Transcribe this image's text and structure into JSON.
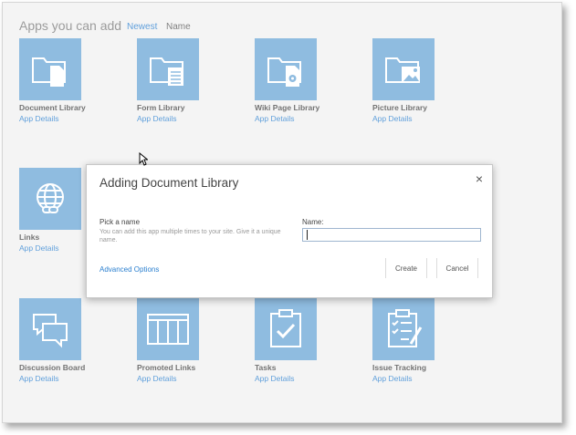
{
  "header": {
    "title": "Apps you can add",
    "sort_newest": "Newest",
    "sort_name": "Name"
  },
  "tiles": [
    {
      "title": "Document Library",
      "details": "App Details",
      "icon": "document-library-icon"
    },
    {
      "title": "Form Library",
      "details": "App Details",
      "icon": "form-library-icon"
    },
    {
      "title": "Wiki Page Library",
      "details": "App Details",
      "icon": "wiki-page-library-icon"
    },
    {
      "title": "Picture Library",
      "details": "App Details",
      "icon": "picture-library-icon"
    },
    {
      "title": "Links",
      "details": "App Details",
      "icon": "links-globe-icon"
    },
    {
      "title": "Discussion Board",
      "details": "App Details",
      "icon": "discussion-board-icon"
    },
    {
      "title": "Promoted Links",
      "details": "App Details",
      "icon": "promoted-links-icon"
    },
    {
      "title": "Tasks",
      "details": "App Details",
      "icon": "tasks-clipboard-icon"
    },
    {
      "title": "Issue Tracking",
      "details": "App Details",
      "icon": "issue-tracking-icon"
    }
  ],
  "dialog": {
    "title": "Adding Document Library",
    "close": "×",
    "pick_label": "Pick a name",
    "pick_description": "You can add this app multiple times to your site. Give it a unique name.",
    "name_label": "Name:",
    "name_value": "",
    "advanced_options": "Advanced Options",
    "create": "Create",
    "cancel": "Cancel"
  },
  "colors": {
    "tile": "#6aa6d6",
    "link": "#2a7fcf",
    "background": "#f1f1f1"
  }
}
